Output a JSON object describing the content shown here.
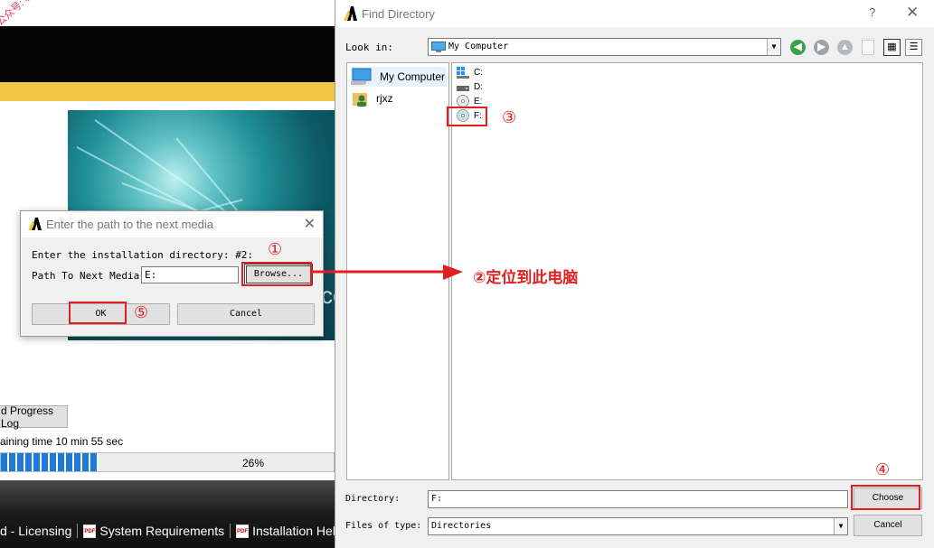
{
  "watermark": "公众号: 软件小梓",
  "installer": {
    "progress_log_button": "d Progress Log",
    "remaining_text": "aining time 10 min 55 sec",
    "progress_text": "26%",
    "progress_fraction": 0.29,
    "splash_text": "ce",
    "footer": {
      "link_licensing": "d - Licensing",
      "link_system_requirements": "System Requirements",
      "link_installation_help": "Installation Help",
      "pdf_icon_text": "PDF"
    }
  },
  "media_dialog": {
    "title": "Enter the path to the next media",
    "close_glyph": "✕",
    "prompt": "Enter the installation directory: #2:",
    "path_label": "Path To Next Media:",
    "path_value": "E:",
    "browse_label": "Browse...",
    "ok_label": "OK",
    "cancel_label": "Cancel"
  },
  "find_directory": {
    "title": "Find Directory",
    "help_glyph": "?",
    "close_glyph": "✕",
    "look_in_label": "Look in:",
    "look_in_value": "My Computer",
    "dropdown_arrow": "▼",
    "toolbar": {
      "back_glyph": "◀",
      "forward_glyph": "▶",
      "up_glyph": "▲",
      "list_view_glyph": "▦",
      "detail_view_glyph": "☰"
    },
    "places": [
      {
        "label": "My Computer",
        "icon": "computer-icon",
        "selected": true
      },
      {
        "label": "rjxz",
        "icon": "user-folder-icon",
        "selected": false
      }
    ],
    "files": [
      {
        "label": "C:",
        "icon": "windows-drive-icon"
      },
      {
        "label": "D:",
        "icon": "hard-drive-icon"
      },
      {
        "label": "E:",
        "icon": "cd-drive-icon"
      },
      {
        "label": "F:",
        "icon": "cd-drive-icon"
      }
    ],
    "directory_label": "Directory:",
    "directory_value": "F:",
    "choose_label": "Choose",
    "files_of_type_label": "Files of type:",
    "files_of_type_value": "Directories",
    "cancel_label": "Cancel"
  },
  "annotations": {
    "step1": "①",
    "step2": "②定位到此电脑",
    "step3": "③",
    "step4": "④",
    "step5": "⑤",
    "color": "#e02020"
  }
}
